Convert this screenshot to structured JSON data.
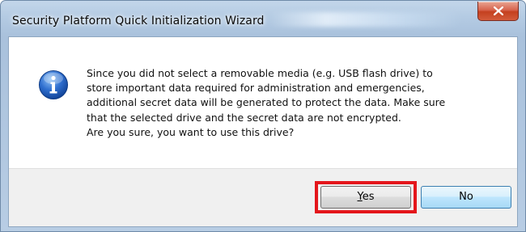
{
  "window": {
    "title": "Security Platform Quick Initialization Wizard"
  },
  "dialog": {
    "icon": "information-icon",
    "message_lines": [
      "Since you did not select a removable media (e.g. USB flash drive) to",
      "store important data required for administration and emergencies,",
      "additional secret data will be generated to protect the data. Make sure",
      "that the selected drive and the secret data are not encrypted.",
      "Are you sure, you want to use this drive?"
    ]
  },
  "buttons": {
    "yes": {
      "accelerator": "Y",
      "rest": "es"
    },
    "no": {
      "label": "No"
    }
  },
  "colors": {
    "highlight": "#e4161b",
    "close_button": "#c4401f",
    "title_bar": "#b4cbe3"
  }
}
